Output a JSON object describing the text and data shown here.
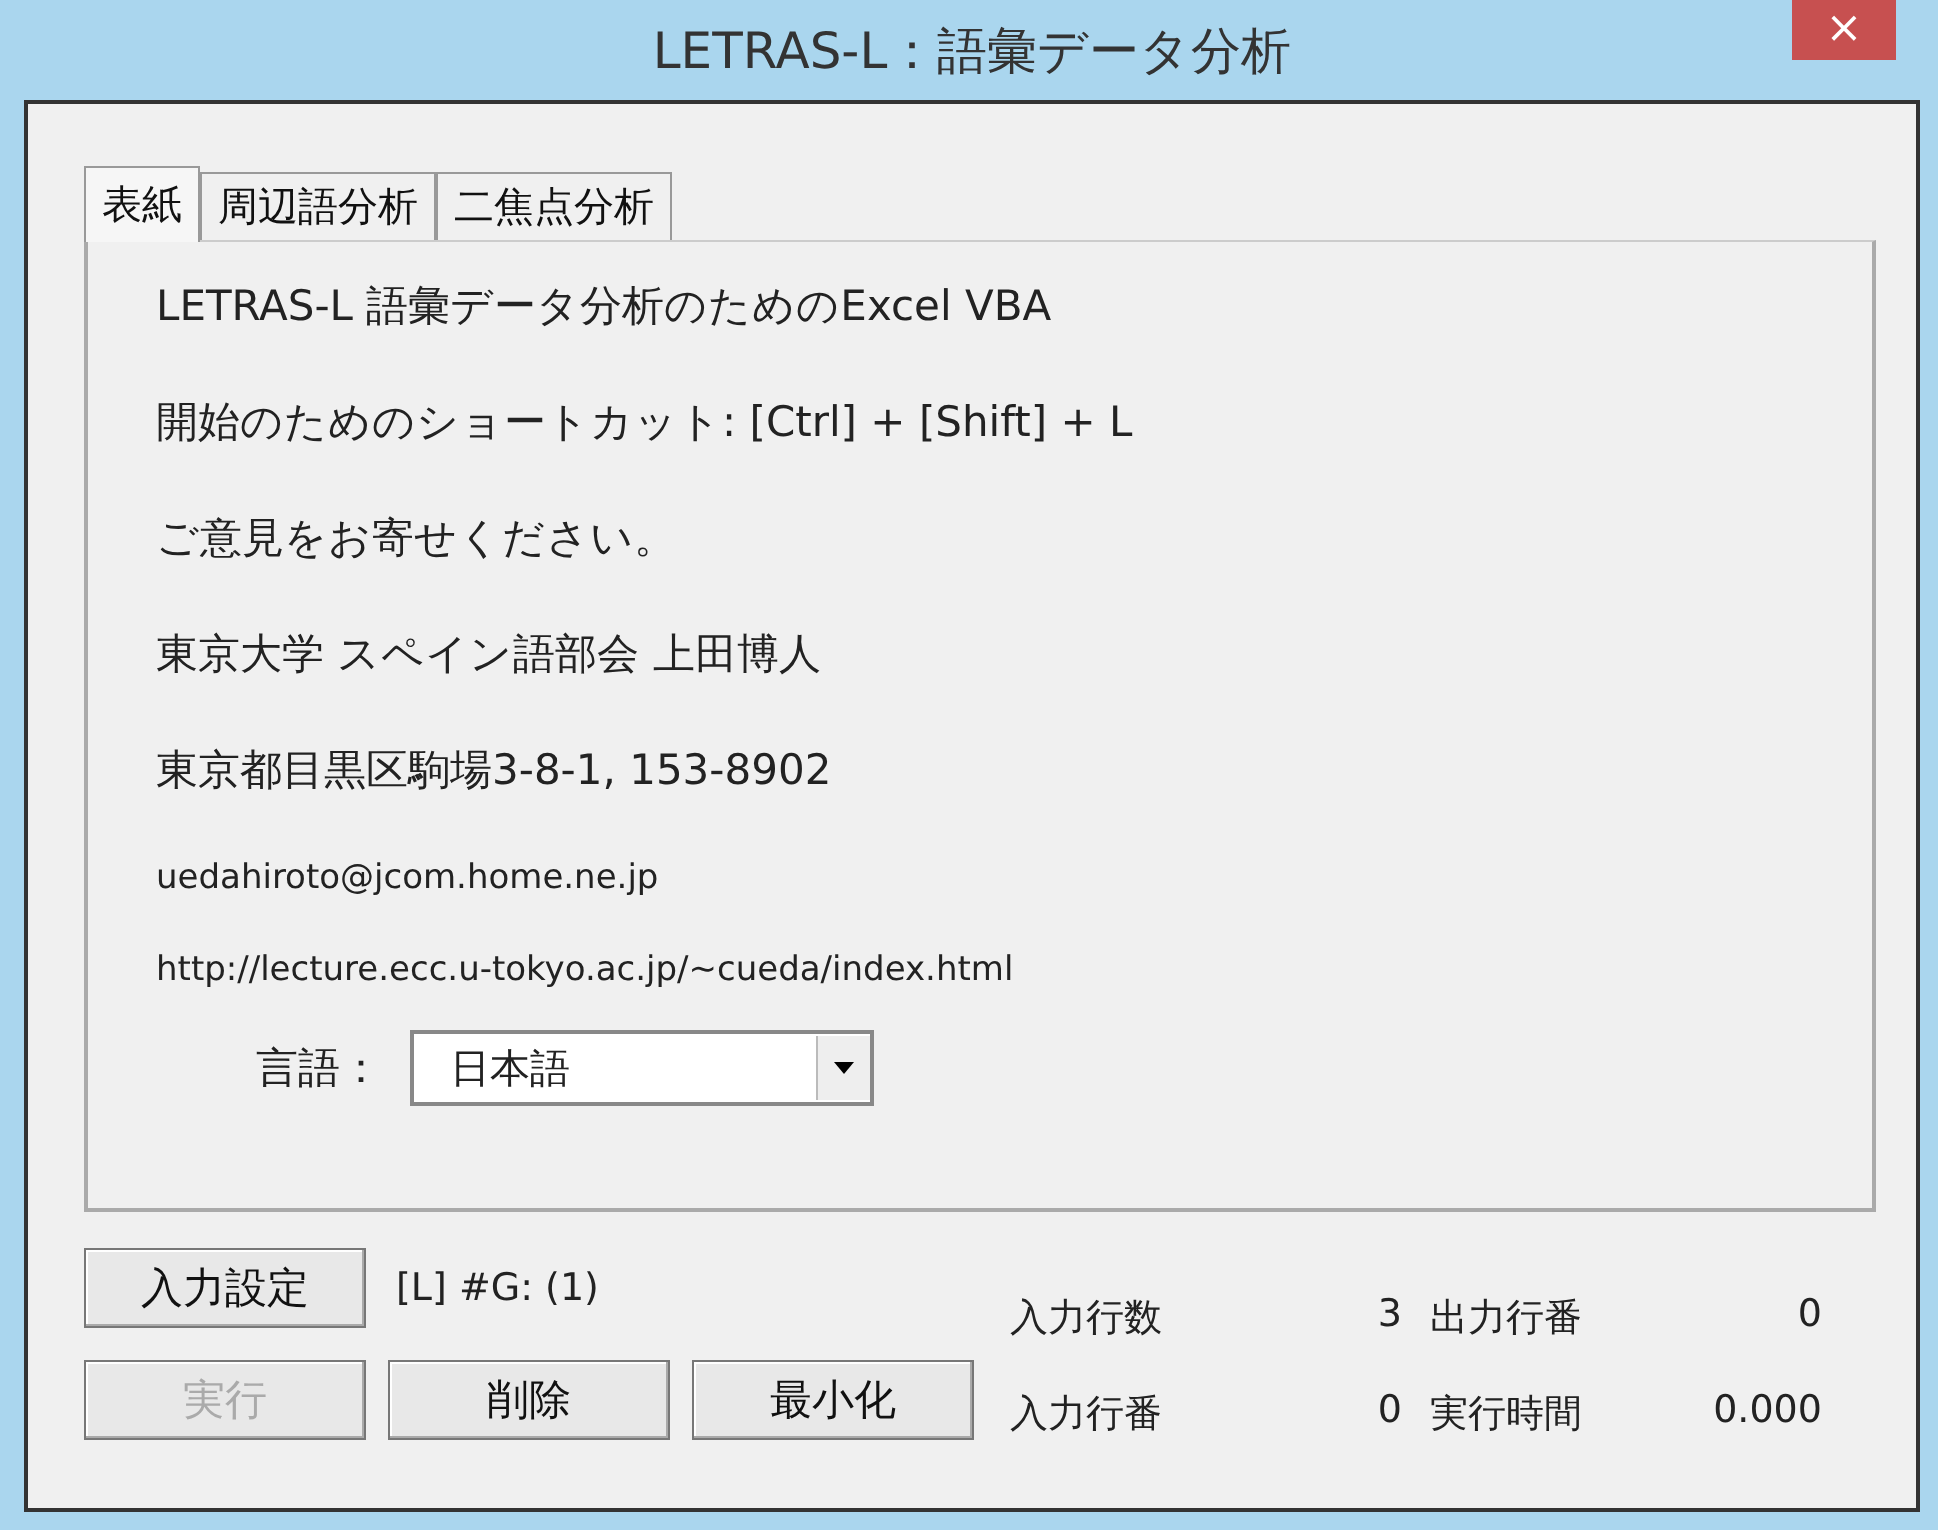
{
  "window": {
    "title": "LETRAS-L：語彙データ分析",
    "close": "×"
  },
  "tabs": [
    {
      "label": "表紙",
      "selected": true
    },
    {
      "label": "周辺語分析",
      "selected": false
    },
    {
      "label": "二焦点分析",
      "selected": false
    }
  ],
  "cover_lines": [
    {
      "text": "LETRAS-L 語彙データ分析のためのExcel VBA",
      "kind": "large"
    },
    {
      "text": "開始のためのショートカット: [Ctrl] + [Shift] + L",
      "kind": "large"
    },
    {
      "text": "ご意見をお寄せください。",
      "kind": "large"
    },
    {
      "text": "東京大学  スペイン語部会   上田博人",
      "kind": "large"
    },
    {
      "text": "東京都目黒区駒場3-8-1, 153-8902",
      "kind": "large"
    },
    {
      "text": "uedahiroto@jcom.home.ne.jp",
      "kind": "small"
    },
    {
      "text": "http://lecture.ecc.u-tokyo.ac.jp/~cueda/index.html",
      "kind": "small"
    }
  ],
  "language": {
    "label": "言語：",
    "value": "日本語"
  },
  "input_settings_button": {
    "label": "入力設定",
    "disabled": false
  },
  "group_label": "[L] #G: (1)",
  "buttons": [
    {
      "label": "実行",
      "disabled": true
    },
    {
      "label": "削除",
      "disabled": false
    },
    {
      "label": "最小化",
      "disabled": false
    }
  ],
  "stats": [
    {
      "label": "入力行数",
      "value": "3"
    },
    {
      "label": "出力行番",
      "value": "0"
    },
    {
      "label": "入力行番",
      "value": "0"
    },
    {
      "label": "実行時間",
      "value": "0.000"
    }
  ]
}
